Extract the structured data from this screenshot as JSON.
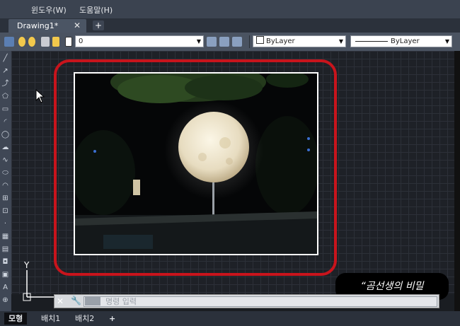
{
  "menubar": {
    "items": [
      "윈도우(W)",
      "도움말(H)"
    ]
  },
  "tabs": {
    "document": "Drawing1*",
    "close": "✕",
    "new": "+"
  },
  "toolbar": {
    "layer_value": "0",
    "color_value": "ByLayer",
    "linetype_value": "ByLayer"
  },
  "ucs": {
    "axis_y": "Y"
  },
  "command": {
    "placeholder": "명령 입력"
  },
  "watermark": "“곰선생의 비밀",
  "layout_tabs": [
    "모형",
    "배치1",
    "배치2"
  ],
  "add_layout": "+",
  "colors": {
    "highlight": "#c8141c",
    "canvas": "#1e2127",
    "menubar": "#3b4350"
  }
}
